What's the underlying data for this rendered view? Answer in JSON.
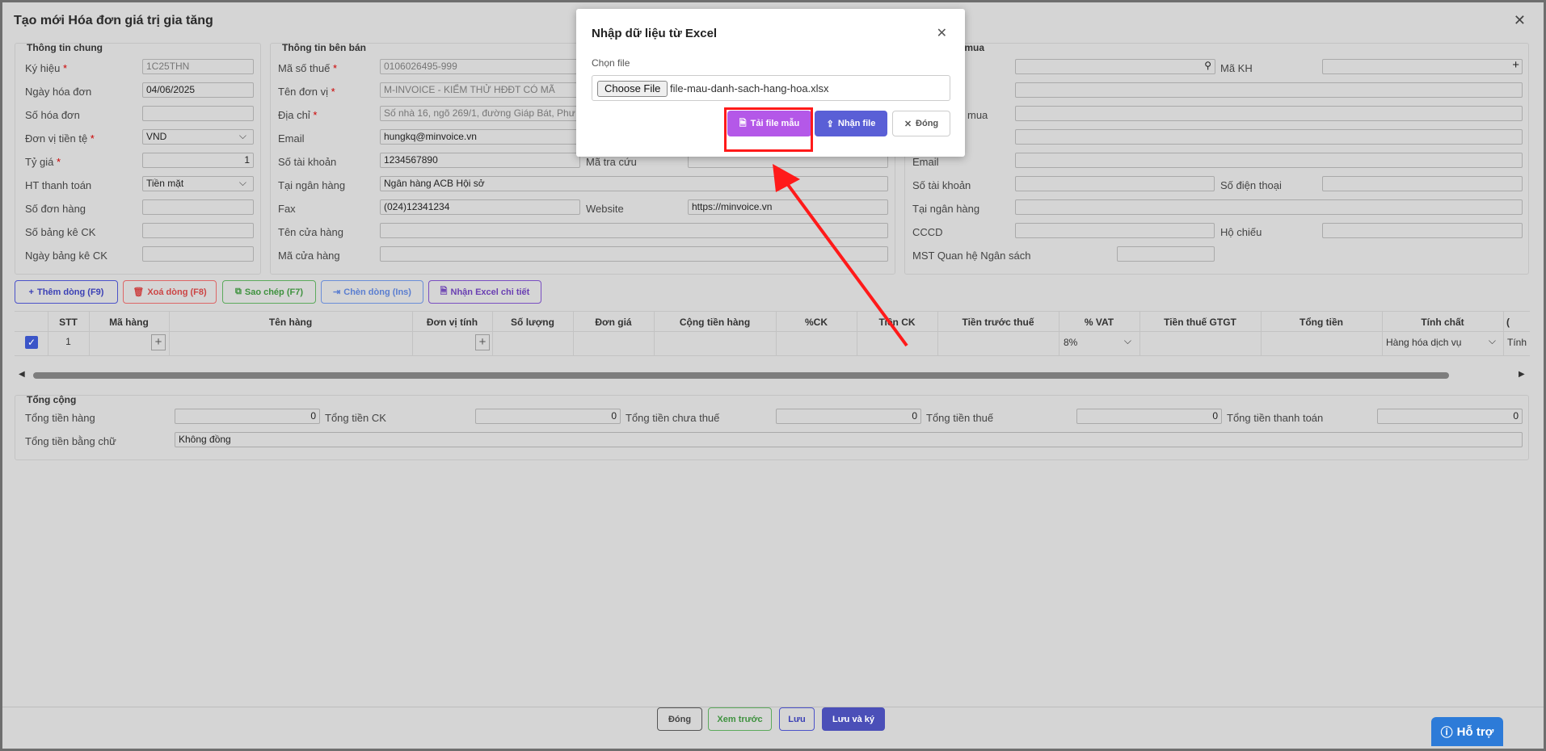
{
  "window": {
    "title": "Tạo mới Hóa đơn giá trị gia tăng"
  },
  "general": {
    "title": "Thông tin chung",
    "ky_hieu_label": "Ký hiệu",
    "ky_hieu": "1C25THN",
    "ngay_label": "Ngày hóa đơn",
    "ngay": "04/06/2025",
    "so_hd_label": "Số hóa đơn",
    "don_vi_tien_label": "Đơn vị tiền tệ",
    "don_vi_tien": "VND",
    "ty_gia_label": "Tỷ giá",
    "ty_gia": "1",
    "ht_thanh_toan_label": "HT thanh toán",
    "ht_thanh_toan": "Tiền mặt",
    "so_don_hang_label": "Số đơn hàng",
    "so_bang_ke_label": "Số bảng kê CK",
    "ngay_bang_ke_label": "Ngày bảng kê CK"
  },
  "seller": {
    "title": "Thông tin bên bán",
    "mst_label": "Mã số thuế",
    "mst": "0106026495-999",
    "ten_label": "Tên đơn vị",
    "ten": "M-INVOICE - KIỂM THỬ HĐĐT CÓ MÃ",
    "dia_chi_label": "Địa chỉ",
    "dia_chi": "Số nhà 16, ngõ 269/1, đường Giáp Bát, Phư",
    "email_label": "Email",
    "email": "hungkq@minvoice.vn",
    "stk_label": "Số tài khoản",
    "stk": "1234567890",
    "ma_tra_cuu_label": "Mã tra cứu",
    "ngan_hang_label": "Tại ngân hàng",
    "ngan_hang": "Ngân hàng ACB Hội sở",
    "fax_label": "Fax",
    "fax": "(024)12341234",
    "website_label": "Website",
    "website": "https://minvoice.vn",
    "ten_cua_hang_label": "Tên cửa hàng",
    "ma_cua_hang_label": "Mã cửa hàng"
  },
  "buyer": {
    "title": "ên mua",
    "ma_kh_label": "Mã KH",
    "mua_label": "mua",
    "email_label": "Email",
    "stk_label": "Số tài khoản",
    "sdt_label": "Số điện thoại",
    "ngan_hang_label": "Tại ngân hàng",
    "cccd_label": "CCCD",
    "ho_chieu_label": "Hộ chiếu",
    "mst_ns_label": "MST Quan hệ Ngân sách"
  },
  "toolbar": {
    "add": "Thêm dòng (F9)",
    "delete": "Xoá dòng (F8)",
    "copy": "Sao chép (F7)",
    "insert": "Chèn dòng (Ins)",
    "excel": "Nhận Excel chi tiết"
  },
  "table": {
    "headers": [
      "STT",
      "Mã hàng",
      "Tên hàng",
      "Đơn vị tính",
      "Số lượng",
      "Đơn giá",
      "Cộng tiền hàng",
      "%CK",
      "Tiền CK",
      "Tiền trước thuế",
      "% VAT",
      "Tiền thuế GTGT",
      "Tổng tiền",
      "Tính chất",
      "("
    ],
    "row": {
      "stt": "1",
      "vat": "8%",
      "tinh_chat": "Hàng hóa dịch vụ",
      "extra": "Tính"
    }
  },
  "totals": {
    "title": "Tổng cộng",
    "tong_tien_hang_label": "Tổng tiền hàng",
    "tong_tien_hang": "0",
    "tong_ck_label": "Tổng tiền CK",
    "tong_ck": "0",
    "chua_thue_label": "Tổng tiền chưa thuế",
    "chua_thue": "0",
    "thue_label": "Tổng tiền thuế",
    "thue": "0",
    "thanh_toan_label": "Tổng tiền thanh toán",
    "thanh_toan": "0",
    "bang_chu_label": "Tổng tiền bằng chữ",
    "bang_chu": "Không đồng"
  },
  "footer": {
    "close": "Đóng",
    "preview": "Xem trước",
    "save": "Lưu",
    "save_sign": "Lưu và ký"
  },
  "modal": {
    "title": "Nhập dữ liệu từ Excel",
    "choose_label": "Chọn file",
    "choose_button": "Choose File",
    "file_name": "file-mau-danh-sach-hang-hoa.xlsx",
    "download": "Tải file mẫu",
    "receive": "Nhận file",
    "close": "Đóng"
  },
  "help": {
    "label": "Hỗ trợ"
  }
}
